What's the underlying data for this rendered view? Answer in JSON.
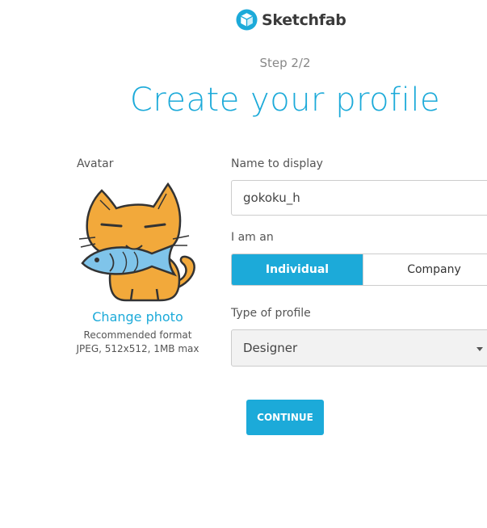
{
  "brand": {
    "name": "Sketchfab",
    "logo_icon": "sketchfab-cube-icon",
    "accent": "#1caad9"
  },
  "step": "Step 2/2",
  "title": "Create your profile",
  "avatar": {
    "label": "Avatar",
    "image": "cat-with-fish-avatar",
    "change_label": "Change photo",
    "hint_line1": "Recommended format",
    "hint_line2": "JPEG, 512x512, 1MB max"
  },
  "form": {
    "name_label": "Name to display",
    "name_value": "gokoku_h",
    "iam_label": "I am an",
    "iam_options": [
      "Individual",
      "Company"
    ],
    "iam_selected": "Individual",
    "type_label": "Type of profile",
    "type_value": "Designer"
  },
  "continue_label": "CONTINUE"
}
